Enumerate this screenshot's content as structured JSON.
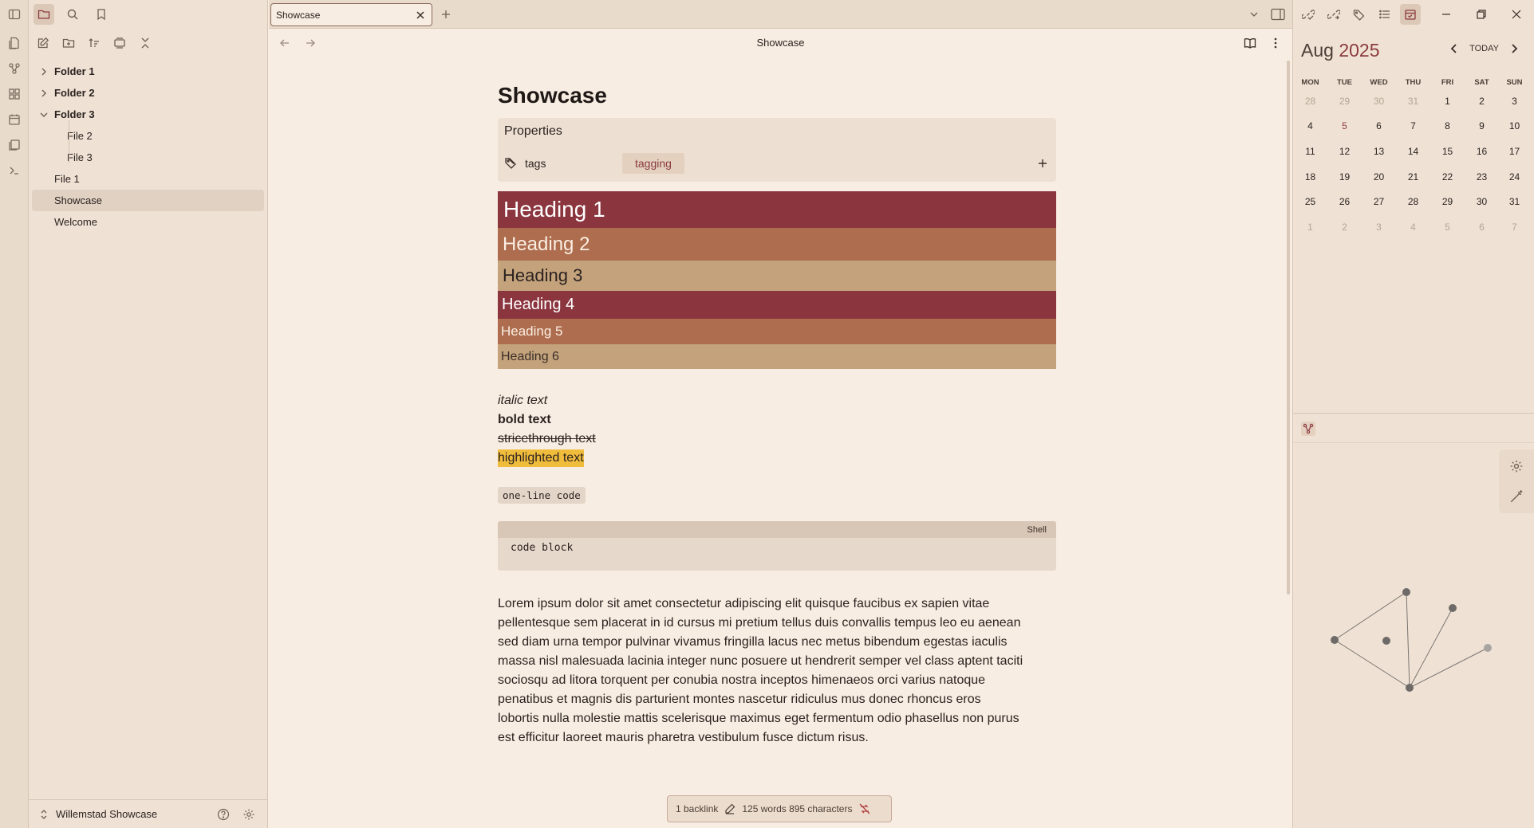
{
  "ribbon": {
    "icons": [
      "toggle-sidebar-icon",
      "open-quick-switcher-icon",
      "graph-view-icon",
      "canvas-icon",
      "daily-note-icon",
      "templates-icon",
      "terminal-icon"
    ]
  },
  "tab": {
    "title": "Showcase"
  },
  "view": {
    "title": "Showcase"
  },
  "file_tree": [
    {
      "label": "Folder 1",
      "type": "folder",
      "expanded": false
    },
    {
      "label": "Folder 2",
      "type": "folder",
      "expanded": false
    },
    {
      "label": "Folder 3",
      "type": "folder",
      "expanded": true
    },
    {
      "label": "File 2",
      "type": "file",
      "nested": true
    },
    {
      "label": "File 3",
      "type": "file",
      "nested": true
    },
    {
      "label": "File 1",
      "type": "file"
    },
    {
      "label": "Showcase",
      "type": "file",
      "selected": true
    },
    {
      "label": "Welcome",
      "type": "file"
    }
  ],
  "vault": {
    "name": "Willemstad Showcase"
  },
  "note": {
    "title": "Showcase",
    "properties_label": "Properties",
    "property_key": "tags",
    "property_tag": "tagging",
    "headings": [
      "Heading 1",
      "Heading 2",
      "Heading 3",
      "Heading 4",
      "Heading 5",
      "Heading 6"
    ],
    "italic": "italic text",
    "bold": "bold text",
    "strike": "stricethrough text",
    "highlight": "highlighted text",
    "inline_code": "one-line code",
    "code_lang": "Shell",
    "code_block": "code block",
    "paragraph_lines": [
      "Lorem ipsum dolor sit amet consectetur adipiscing elit quisque faucibus ex sapien vitae",
      "pellentesque sem placerat in id cursus mi pretium tellus duis convallis tempus leo eu aenean",
      "sed diam urna tempor pulvinar vivamus fringilla lacus nec metus bibendum egestas iaculis",
      "massa nisl malesuada lacinia integer nunc posuere ut hendrerit semper vel class aptent taciti",
      "sociosqu ad litora torquent per conubia nostra inceptos himenaeos orci varius natoque",
      "penatibus et magnis dis parturient montes nascetur ridiculus mus donec rhoncus eros",
      "lobortis nulla molestie mattis scelerisque maximus eget fermentum odio phasellus non purus",
      "est efficitur laoreet mauris pharetra vestibulum fusce dictum risus."
    ]
  },
  "status": {
    "backlinks": "1 backlink",
    "counts": "125 words 895 characters"
  },
  "calendar": {
    "month": "Aug",
    "year": "2025",
    "today_label": "TODAY",
    "weekdays": [
      "MON",
      "TUE",
      "WED",
      "THU",
      "FRI",
      "SAT",
      "SUN"
    ],
    "weeks": [
      [
        [
          "28",
          "dim"
        ],
        [
          "29",
          "dim"
        ],
        [
          "30",
          "dim"
        ],
        [
          "31",
          "dim"
        ],
        [
          "1",
          ""
        ],
        [
          "2",
          ""
        ],
        [
          "3",
          ""
        ]
      ],
      [
        [
          "4",
          ""
        ],
        [
          "5",
          "today"
        ],
        [
          "6",
          ""
        ],
        [
          "7",
          ""
        ],
        [
          "8",
          ""
        ],
        [
          "9",
          ""
        ],
        [
          "10",
          ""
        ]
      ],
      [
        [
          "11",
          ""
        ],
        [
          "12",
          ""
        ],
        [
          "13",
          ""
        ],
        [
          "14",
          ""
        ],
        [
          "15",
          ""
        ],
        [
          "16",
          ""
        ],
        [
          "17",
          ""
        ]
      ],
      [
        [
          "18",
          ""
        ],
        [
          "19",
          ""
        ],
        [
          "20",
          ""
        ],
        [
          "21",
          ""
        ],
        [
          "22",
          ""
        ],
        [
          "23",
          ""
        ],
        [
          "24",
          ""
        ]
      ],
      [
        [
          "25",
          ""
        ],
        [
          "26",
          ""
        ],
        [
          "27",
          ""
        ],
        [
          "28",
          ""
        ],
        [
          "29",
          ""
        ],
        [
          "30",
          ""
        ],
        [
          "31",
          ""
        ]
      ],
      [
        [
          "1",
          "dim"
        ],
        [
          "2",
          "dim"
        ],
        [
          "3",
          "dim"
        ],
        [
          "4",
          "dim"
        ],
        [
          "5",
          "dim"
        ],
        [
          "6",
          "dim"
        ],
        [
          "7",
          "dim"
        ]
      ]
    ]
  },
  "colors": {
    "accent": "#8b3a3f",
    "heading_dark_red": "#8b353e",
    "heading_rust": "#ad6d4e",
    "heading_tan": "#c4a37c",
    "highlight": "#f0bc3c",
    "background": "#f8ede2"
  }
}
